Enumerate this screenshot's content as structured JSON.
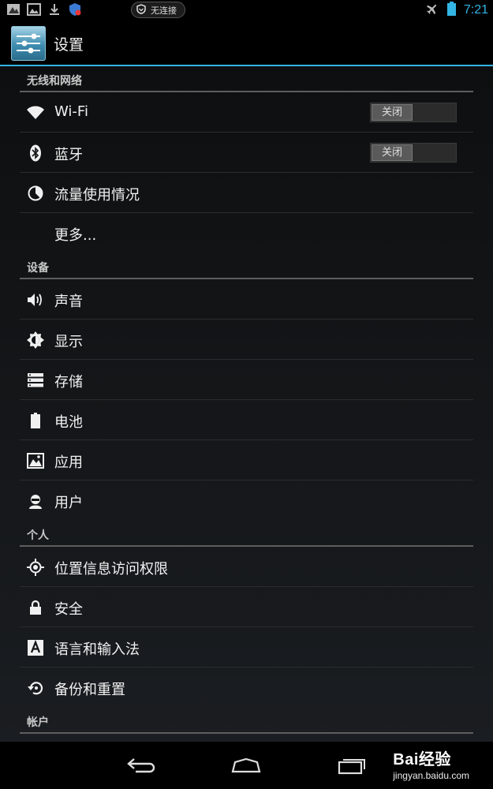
{
  "status_bar": {
    "icons": [
      "image-icon",
      "gallery-icon",
      "download-icon",
      "security-app-icon"
    ],
    "connection_text": "无连接",
    "time": "7:21",
    "accent_color": "#33b5e5"
  },
  "action_bar": {
    "title": "设置",
    "accent_color": "#33b5e5"
  },
  "sections": [
    {
      "header": "无线和网络",
      "items": [
        {
          "label": "Wi-Fi",
          "icon": "wifi-icon",
          "toggle": "关闭"
        },
        {
          "label": "蓝牙",
          "icon": "bluetooth-icon",
          "toggle": "关闭"
        },
        {
          "label": "流量使用情况",
          "icon": "data-usage-icon"
        },
        {
          "label": "更多...",
          "icon": ""
        }
      ]
    },
    {
      "header": "设备",
      "items": [
        {
          "label": "声音",
          "icon": "sound-icon"
        },
        {
          "label": "显示",
          "icon": "display-icon"
        },
        {
          "label": "存储",
          "icon": "storage-icon"
        },
        {
          "label": "电池",
          "icon": "battery-icon"
        },
        {
          "label": "应用",
          "icon": "apps-icon"
        },
        {
          "label": "用户",
          "icon": "user-icon"
        }
      ]
    },
    {
      "header": "个人",
      "items": [
        {
          "label": "位置信息访问权限",
          "icon": "location-icon"
        },
        {
          "label": "安全",
          "icon": "lock-icon"
        },
        {
          "label": "语言和输入法",
          "icon": "language-icon"
        },
        {
          "label": "备份和重置",
          "icon": "backup-icon"
        }
      ]
    },
    {
      "header": "帐户",
      "items": []
    }
  ],
  "nav_bar": {
    "buttons": [
      "back-icon",
      "home-icon",
      "recents-icon"
    ],
    "watermark_brand": "Bai经验",
    "watermark_url": "jingyan.baidu.com"
  }
}
